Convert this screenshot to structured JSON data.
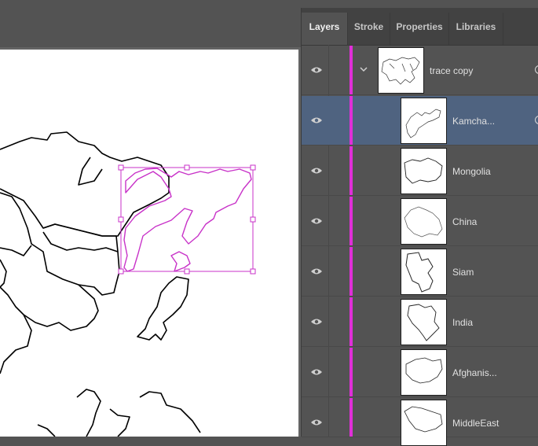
{
  "panel": {
    "tabs": [
      {
        "label": "Layers",
        "active": true
      },
      {
        "label": "Stroke",
        "active": false
      },
      {
        "label": "Properties",
        "active": false
      },
      {
        "label": "Libraries",
        "active": false
      }
    ],
    "parent_layer": {
      "name": "trace copy",
      "expanded": true
    },
    "layers": [
      {
        "name": "Kamcha...",
        "selected": true
      },
      {
        "name": "Mongolia",
        "selected": false
      },
      {
        "name": "China",
        "selected": false
      },
      {
        "name": "Siam",
        "selected": false
      },
      {
        "name": "India",
        "selected": false
      },
      {
        "name": "Afghanis...",
        "selected": false
      },
      {
        "name": "MiddleEast",
        "selected": false
      }
    ]
  },
  "colors": {
    "layer_color": "#e02fd8",
    "selection_highlight": "#4f6380",
    "selection_bbox": "#c832c8"
  },
  "icons": {
    "visibility": "eye-icon",
    "expand": "chevron-down-icon",
    "target": "target-circle-icon"
  }
}
